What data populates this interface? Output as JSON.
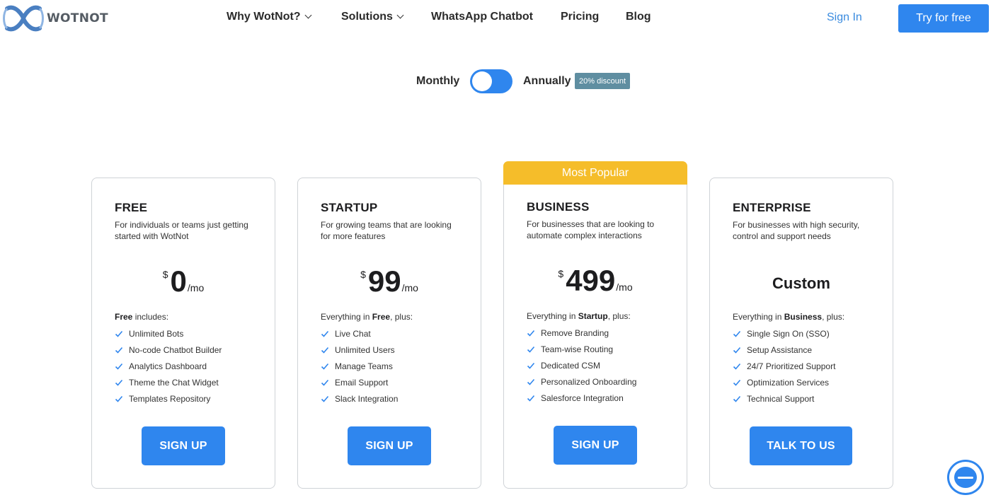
{
  "brand": {
    "name": "WOTNOT",
    "accent": "#2f86ee",
    "popular_color": "#f5bd2a"
  },
  "nav": {
    "items": [
      {
        "label": "Why WotNot?",
        "has_dropdown": true
      },
      {
        "label": "Solutions",
        "has_dropdown": true
      },
      {
        "label": "WhatsApp Chatbot",
        "has_dropdown": false
      },
      {
        "label": "Pricing",
        "has_dropdown": false
      },
      {
        "label": "Blog",
        "has_dropdown": false
      }
    ],
    "sign_in": "Sign In",
    "try_free": "Try for free"
  },
  "billing": {
    "monthly_label": "Monthly",
    "annually_label": "Annually",
    "discount_badge": "20% discount",
    "annual_selected": false
  },
  "popular_ribbon": "Most Popular",
  "plans": [
    {
      "name": "FREE",
      "description": "For individuals or teams just getting started with WotNot",
      "currency": "$",
      "price": "0",
      "period": "/mo",
      "includes_prefix": "",
      "includes_bold": "Free",
      "includes_suffix": " includes:",
      "features": [
        "Unlimited Bots",
        "No-code Chatbot Builder",
        "Analytics Dashboard",
        "Theme the Chat Widget",
        "Templates Repository"
      ],
      "cta": "SIGN UP"
    },
    {
      "name": "STARTUP",
      "description": "For growing teams that are looking for more features",
      "currency": "$",
      "price": "99",
      "period": "/mo",
      "includes_prefix": "Everything in ",
      "includes_bold": "Free",
      "includes_suffix": ", plus:",
      "features": [
        "Live Chat",
        "Unlimited Users",
        "Manage Teams",
        "Email Support",
        "Slack Integration"
      ],
      "cta": "SIGN UP"
    },
    {
      "name": "BUSINESS",
      "description": "For businesses that are looking to automate complex interactions",
      "currency": "$",
      "price": "499",
      "period": "/mo",
      "includes_prefix": "Everything in ",
      "includes_bold": "Startup",
      "includes_suffix": ", plus:",
      "features": [
        "Remove Branding",
        "Team-wise Routing",
        "Dedicated CSM",
        "Personalized Onboarding",
        "Salesforce Integration"
      ],
      "cta": "SIGN UP"
    },
    {
      "name": "ENTERPRISE",
      "description": "For businesses with high security, control and support needs",
      "custom_price": "Custom",
      "includes_prefix": "Everything in ",
      "includes_bold": "Business",
      "includes_suffix": ", plus:",
      "features": [
        "Single Sign On (SSO)",
        "Setup Assistance",
        "24/7 Prioritized Support",
        "Optimization Services",
        "Technical Support"
      ],
      "cta": "TALK TO US"
    }
  ],
  "icons": {
    "check": "check-icon",
    "logo": "wotnot-logo-icon",
    "chat": "chat-widget-icon"
  }
}
